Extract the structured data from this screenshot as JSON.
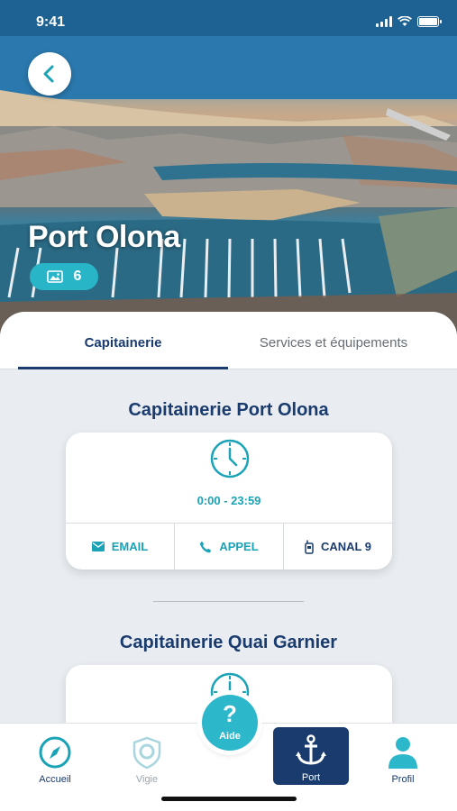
{
  "status_bar": {
    "time": "9:41"
  },
  "hero": {
    "title": "Port Olona",
    "gallery_count": "6",
    "back_icon": "chevron-left-icon"
  },
  "tabs": [
    {
      "label": "Capitainerie",
      "active": true
    },
    {
      "label": "Services et équipements",
      "active": false
    }
  ],
  "offices": [
    {
      "name": "Capitainerie Port Olona",
      "hours": "0:00 - 23:59",
      "actions": [
        {
          "label": "EMAIL",
          "icon": "mail-icon"
        },
        {
          "label": "APPEL",
          "icon": "phone-icon"
        },
        {
          "label": "CANAL 9",
          "icon": "radio-icon"
        }
      ]
    },
    {
      "name": "Capitainerie Quai Garnier"
    }
  ],
  "bottom_nav": [
    {
      "label": "Accueil",
      "icon": "compass-icon"
    },
    {
      "label": "Vigie",
      "icon": "shield-lifebuoy-icon"
    },
    {
      "label": "Port",
      "icon": "anchor-icon",
      "active": true
    },
    {
      "label": "Profil",
      "icon": "user-icon"
    }
  ],
  "help_button": {
    "symbol": "?",
    "label": "Aide"
  },
  "colors": {
    "navy": "#1a3b6e",
    "teal": "#1aa3b6",
    "aqua": "#29b5c8"
  }
}
